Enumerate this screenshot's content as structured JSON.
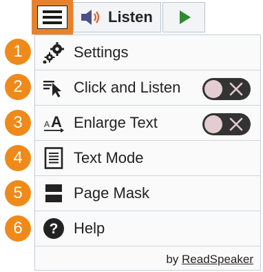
{
  "toolbar": {
    "listen_label": "Listen",
    "accent_color": "#e8822a"
  },
  "menu": {
    "items": [
      {
        "badge": "1",
        "label": "Settings",
        "icon": "gears-icon"
      },
      {
        "badge": "2",
        "label": "Click and Listen",
        "icon": "cursor-text-icon",
        "toggle": "off"
      },
      {
        "badge": "3",
        "label": "Enlarge Text",
        "icon": "enlarge-text-icon",
        "toggle": "off"
      },
      {
        "badge": "4",
        "label": "Text Mode",
        "icon": "document-lines-icon"
      },
      {
        "badge": "5",
        "label": "Page Mask",
        "icon": "page-mask-icon"
      },
      {
        "badge": "6",
        "label": "Help",
        "icon": "question-circle-icon"
      }
    ]
  },
  "footer": {
    "by_text": "by",
    "brand_link": "ReadSpeaker"
  }
}
